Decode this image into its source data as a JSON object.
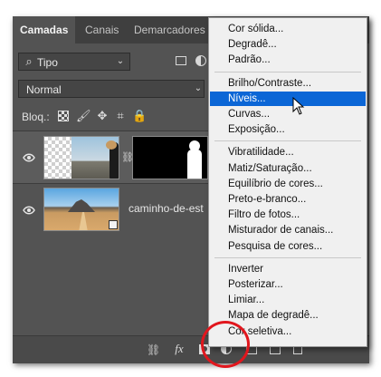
{
  "tabs": [
    "Camadas",
    "Canais",
    "Demarcadores"
  ],
  "filter": {
    "value": "Tipo"
  },
  "blend_mode": {
    "value": "Normal"
  },
  "lock_label": "Bloq.:",
  "layers": [
    {
      "name": "caminho-de-est",
      "type": "image"
    }
  ],
  "bottom_bar": {
    "fx_label": "fx"
  },
  "menu": {
    "groups": [
      [
        "Cor sólida...",
        "Degradê...",
        "Padrão..."
      ],
      [
        "Brilho/Contraste...",
        "Níveis...",
        "Curvas...",
        "Exposição..."
      ],
      [
        "Vibratilidade...",
        "Matiz/Saturação...",
        "Equilíbrio de cores...",
        "Preto-e-branco...",
        "Filtro de fotos...",
        "Misturador de canais...",
        "Pesquisa de cores..."
      ],
      [
        "Inverter",
        "Posterizar...",
        "Limiar...",
        "Mapa de degradê...",
        "Cor seletiva..."
      ]
    ],
    "highlighted": "Níveis...",
    "highlight_color": "#0b66d6"
  },
  "annotation_color": "#e1161d"
}
